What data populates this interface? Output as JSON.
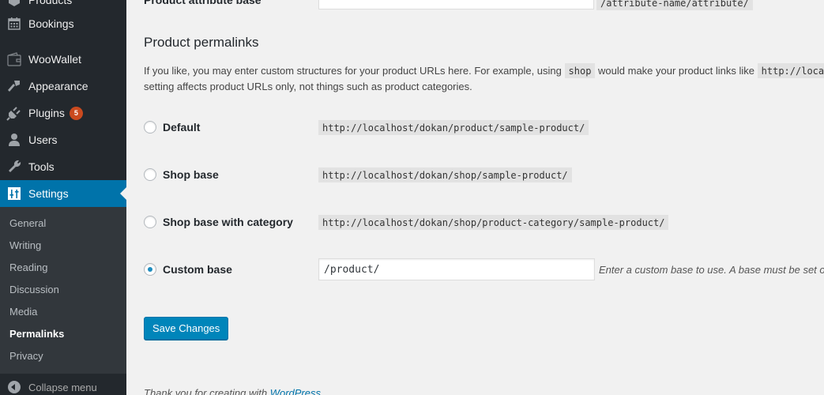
{
  "sidebar": {
    "items": [
      {
        "label": "Products",
        "icon": "products-icon"
      },
      {
        "label": "Bookings",
        "icon": "calendar-icon"
      },
      {
        "label": "WooWallet",
        "icon": "wallet-icon"
      },
      {
        "label": "Appearance",
        "icon": "paintbrush-icon"
      },
      {
        "label": "Plugins",
        "icon": "plugin-icon",
        "badge": "5"
      },
      {
        "label": "Users",
        "icon": "user-icon"
      },
      {
        "label": "Tools",
        "icon": "wrench-icon"
      },
      {
        "label": "Settings",
        "icon": "settings-sliders-icon",
        "current": true
      }
    ],
    "submenu": [
      {
        "label": "General"
      },
      {
        "label": "Writing"
      },
      {
        "label": "Reading"
      },
      {
        "label": "Discussion"
      },
      {
        "label": "Media"
      },
      {
        "label": "Permalinks",
        "current": true
      },
      {
        "label": "Privacy"
      }
    ],
    "collapse_label": "Collapse menu"
  },
  "attribute_base": {
    "label": "Product attribute base",
    "value": "",
    "suffix": "/attribute-name/attribute/"
  },
  "product_permalinks": {
    "title": "Product permalinks",
    "desc_part1": "If you like, you may enter custom structures for your product URLs here. For example, using",
    "desc_code1": "shop",
    "desc_part2": "would make your product links like",
    "desc_code2": "http://localhost/dokan/shop/sample-product/",
    "desc_line2": "setting affects product URLs only, not things such as product categories.",
    "options": [
      {
        "label": "Default",
        "example": "http://localhost/dokan/product/sample-product/",
        "checked": false
      },
      {
        "label": "Shop base",
        "example": "http://localhost/dokan/shop/sample-product/",
        "checked": false
      },
      {
        "label": "Shop base with category",
        "example": "http://localhost/dokan/shop/product-category/sample-product/",
        "checked": false
      },
      {
        "label": "Custom base",
        "checked": true
      }
    ],
    "custom_base_value": "/product/",
    "custom_base_hint": "Enter a custom base to use. A base must be set or WordPress will use default instead."
  },
  "save_button_label": "Save Changes",
  "footer": {
    "text": "Thank you for creating with",
    "link": "WordPress"
  }
}
